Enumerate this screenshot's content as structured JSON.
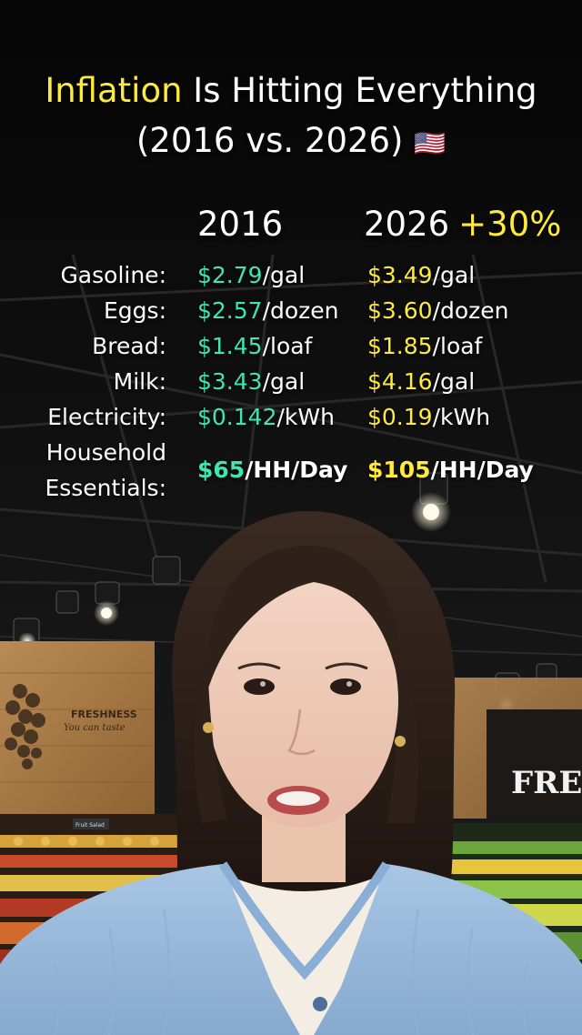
{
  "title": {
    "highlight": "Inflation",
    "rest": " Is Hitting Everything",
    "line2": "(2016 vs. 2026)",
    "flag": "🇺🇸"
  },
  "columns": {
    "year_a": "2016",
    "year_b": "2026",
    "change": "+30%"
  },
  "rows": [
    {
      "label": "Gasoline:",
      "v2016": "$2.79",
      "u2016": "/gal",
      "v2026": "$3.49",
      "u2026": "/gal"
    },
    {
      "label": "Eggs:",
      "v2016": "$2.57",
      "u2016": "/dozen",
      "v2026": "$3.60",
      "u2026": "/dozen"
    },
    {
      "label": "Bread:",
      "v2016": "$1.45",
      "u2016": "/loaf",
      "v2026": "$1.85",
      "u2026": "/loaf"
    },
    {
      "label": "Milk:",
      "v2016": "$3.43",
      "u2016": "/gal",
      "v2026": "$4.16",
      "u2026": "/gal"
    },
    {
      "label": "Electricity:",
      "v2016": "$0.142",
      "u2016": "/kWh",
      "v2026": "$0.19",
      "u2026": "/kWh"
    },
    {
      "label_line1": "Household",
      "label_line2": "Essentials:",
      "v2016": "$65",
      "u2016": "/HH/Day",
      "v2026": "$105",
      "u2026": "/HH/Day"
    }
  ],
  "background": {
    "store_sign_left": "FRESHNESS",
    "store_sign_left_sub": "You can taste",
    "store_sign_right": "FRESH",
    "shelf_tag": "Fruit Salad"
  },
  "colors": {
    "title_accent": "#ffeb3b",
    "price_2016": "#3ee6b4",
    "price_2026": "#ffeb3b"
  }
}
